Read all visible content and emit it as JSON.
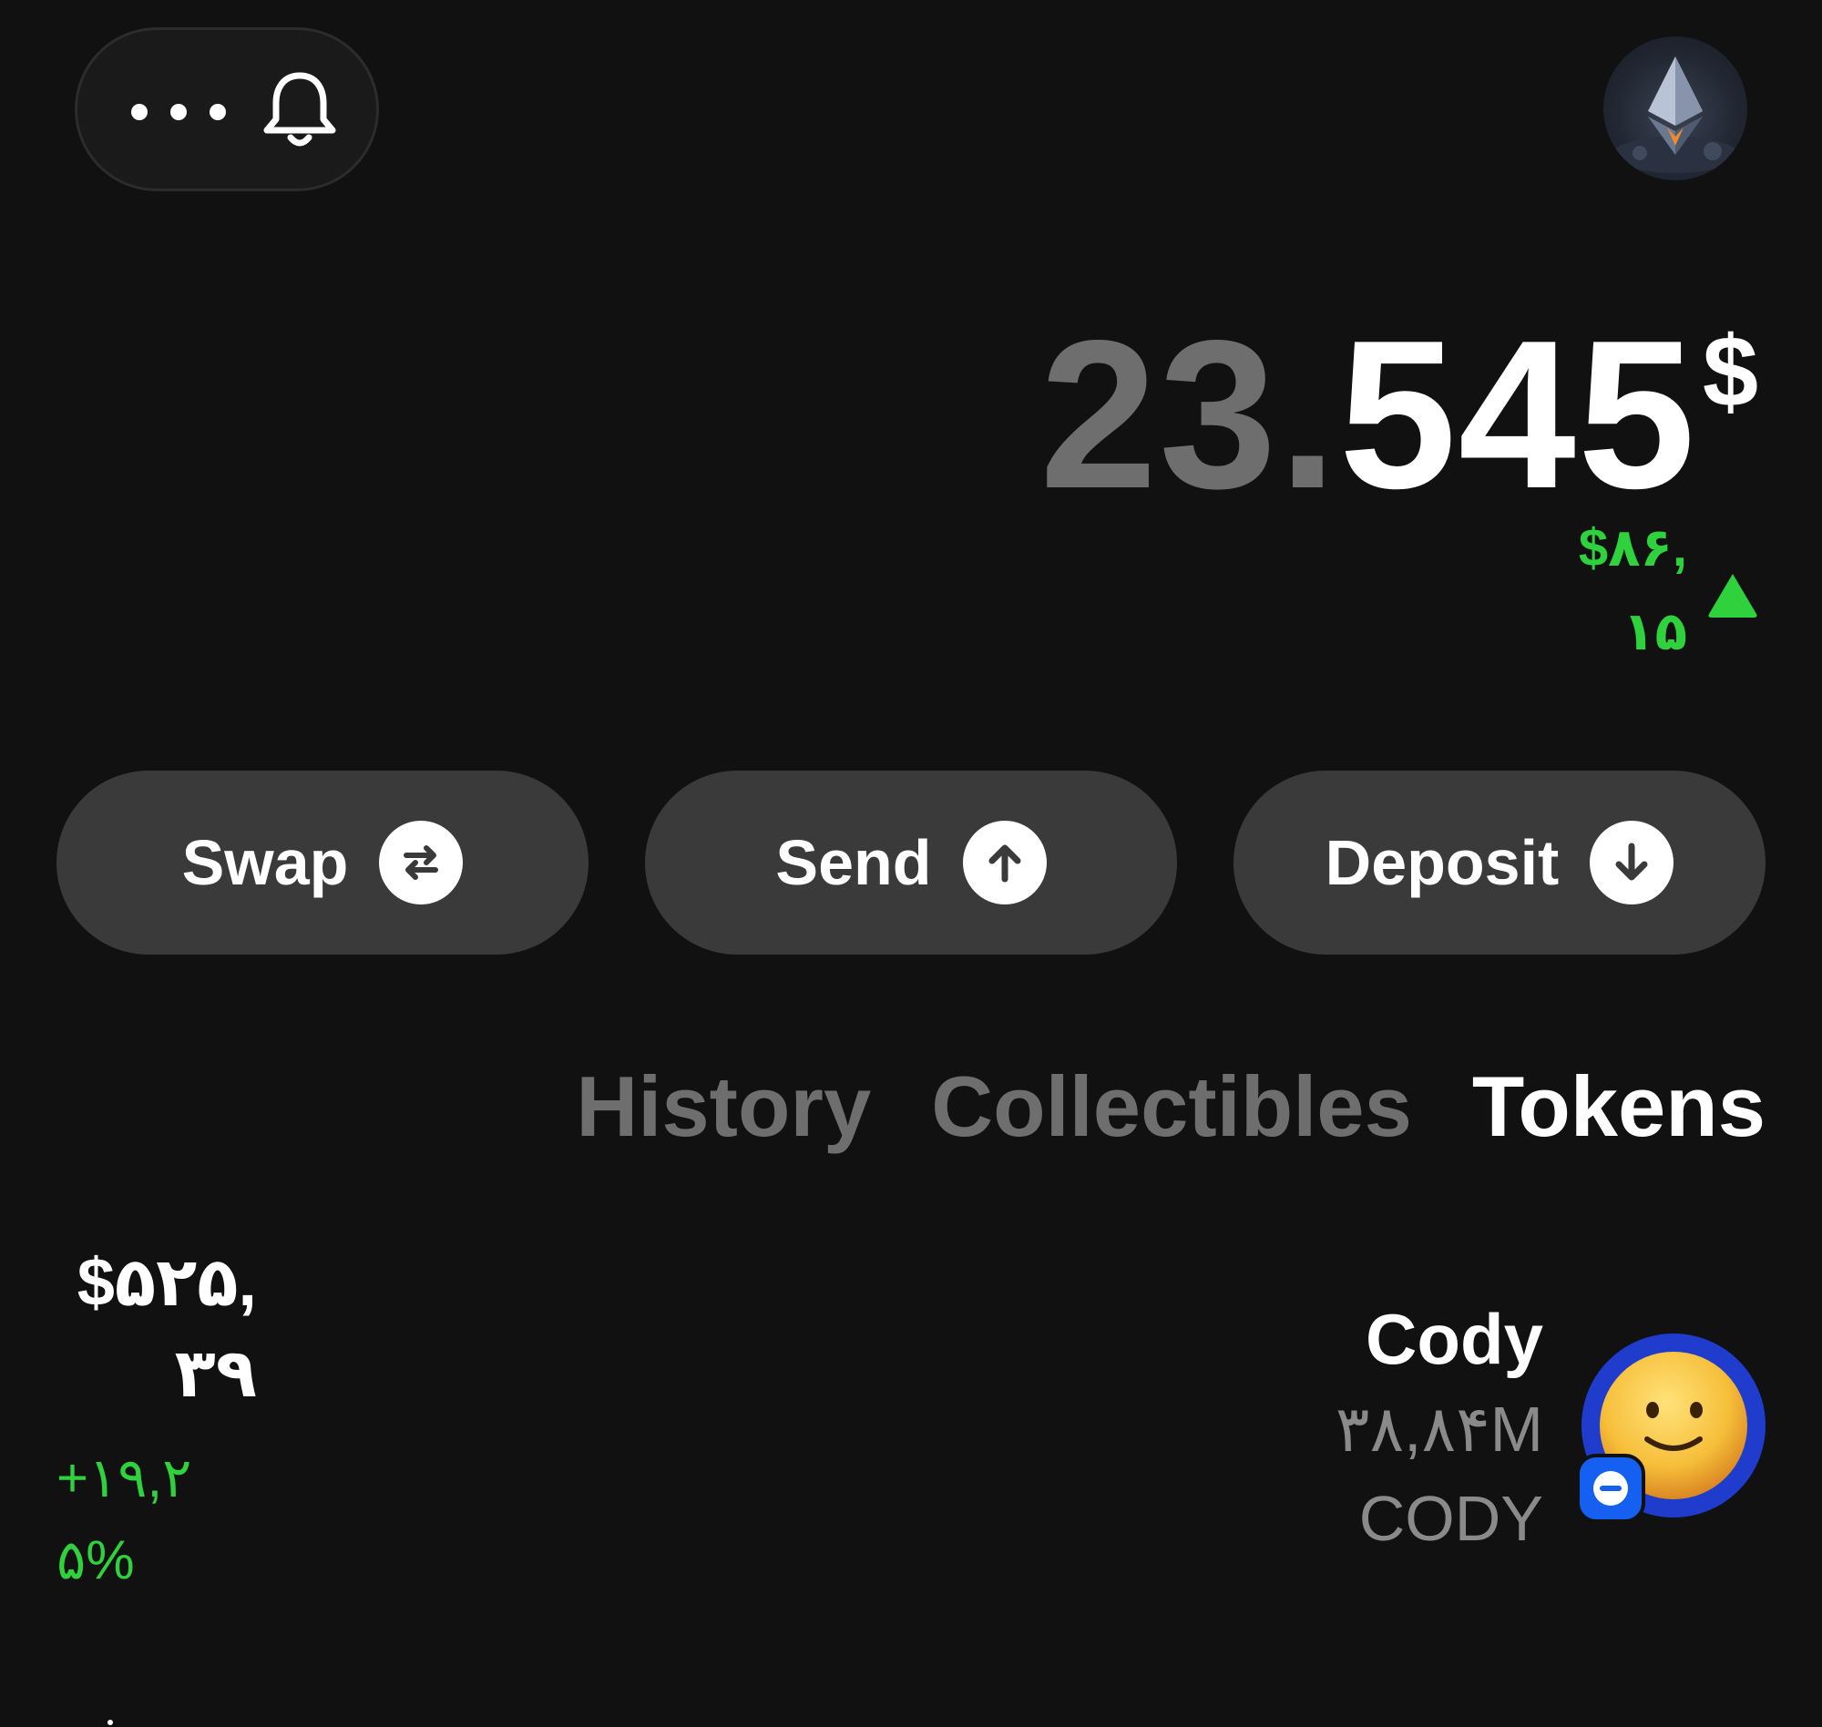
{
  "header": {
    "more_icon": "more-horizontal-icon",
    "notifications_icon": "bell-icon",
    "avatar_icon": "ethereum-avatar"
  },
  "balance": {
    "integer": "23.",
    "fraction": "545",
    "currency": "$",
    "change": "$۸۶,۱۵",
    "change_direction": "up",
    "change_color": "#2fd13c"
  },
  "actions": [
    {
      "label": "Swap",
      "icon": "swap-icon"
    },
    {
      "label": "Send",
      "icon": "arrow-up-icon"
    },
    {
      "label": "Deposit",
      "icon": "arrow-down-icon"
    }
  ],
  "tabs": [
    {
      "label": "History",
      "active": false
    },
    {
      "label": "Collectibles",
      "active": false
    },
    {
      "label": "Tokens",
      "active": true
    }
  ],
  "tokens": [
    {
      "name": "Cody",
      "balance": "۳۸,۸۴M CODY",
      "value": "$۵۲۵,۳۹",
      "change": "+۱۹,۲۵%",
      "change_color": "#2fd13c",
      "icon": "smiley-token-icon",
      "chain_badge_icon": "chain-badge-icon"
    }
  ],
  "colors": {
    "background": "#111111",
    "button_bg": "#3a3a3a",
    "muted_text": "#6e6e6e",
    "positive": "#2fd13c",
    "token_ring": "#1f3ccc"
  }
}
